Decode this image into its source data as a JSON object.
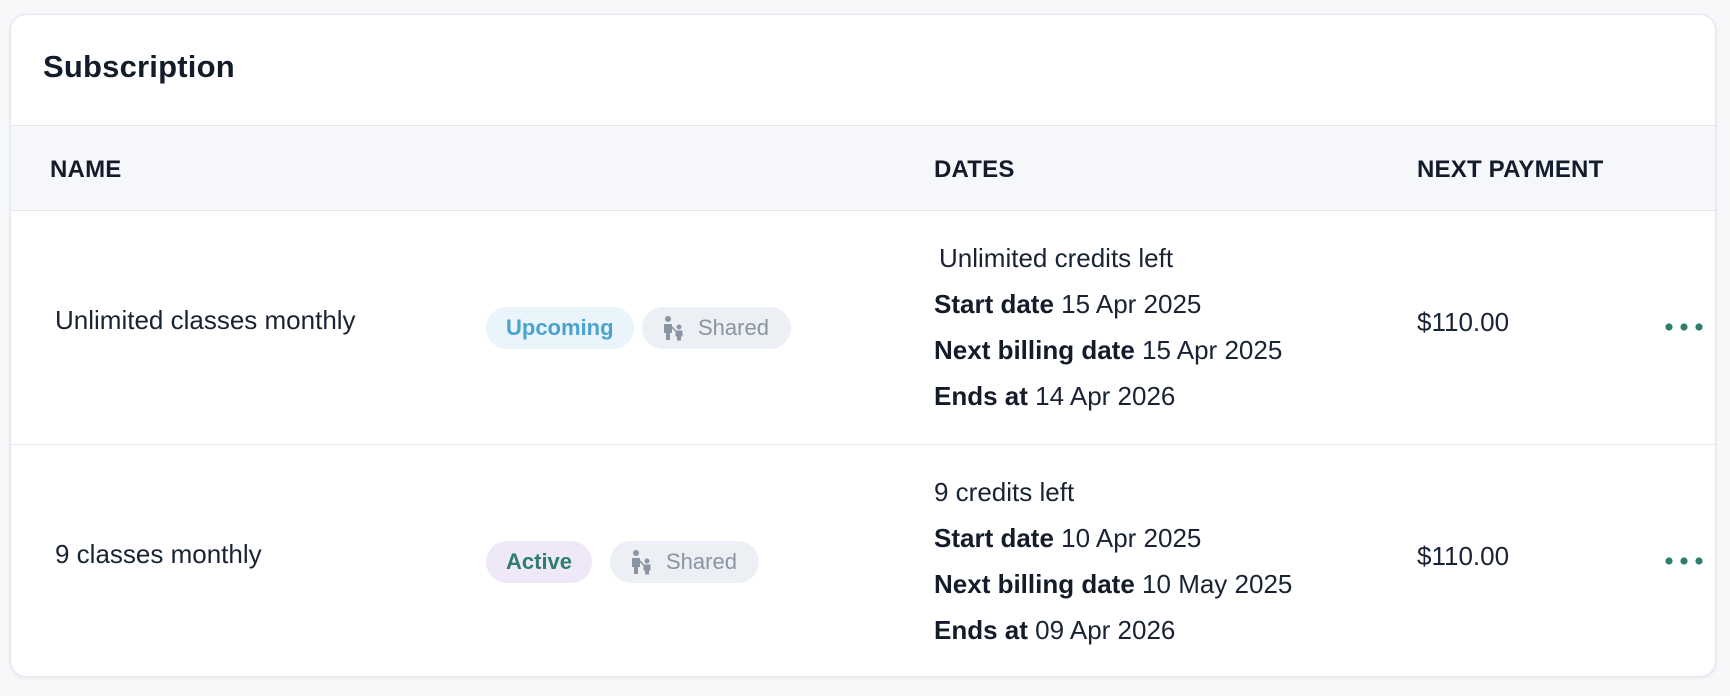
{
  "card": {
    "title": "Subscription"
  },
  "table": {
    "headers": {
      "name": "NAME",
      "dates": "DATES",
      "next_payment": "NEXT PAYMENT"
    },
    "rows": [
      {
        "name": "Unlimited classes monthly",
        "status": "Upcoming",
        "shared": "Shared",
        "credits": "Unlimited credits left",
        "start_label": "Start date",
        "start_value": "15 Apr 2025",
        "billing_label": "Next billing date",
        "billing_value": "15 Apr 2025",
        "ends_label": "Ends at",
        "ends_value": "14 Apr 2026",
        "next_payment": "$110.00",
        "more_icon": "more-horizontal-icon"
      },
      {
        "name": "9 classes monthly",
        "status": "Active",
        "shared": "Shared",
        "credits": "9 credits left",
        "start_label": "Start date",
        "start_value": "10 Apr 2025",
        "billing_label": "Next billing date",
        "billing_value": "10 May 2025",
        "ends_label": "Ends at",
        "ends_value": "09 Apr 2026",
        "next_payment": "$110.00",
        "more_icon": "more-horizontal-icon"
      }
    ]
  },
  "colors": {
    "upcoming_text": "#4aa3d0",
    "upcoming_bg": "#eaf4fb",
    "active_text": "#2e7d6e",
    "active_bg": "#efe8f8",
    "shared_text": "#8a94a3",
    "shared_bg": "#eceff4",
    "more_icon": "#2e7d6e"
  }
}
